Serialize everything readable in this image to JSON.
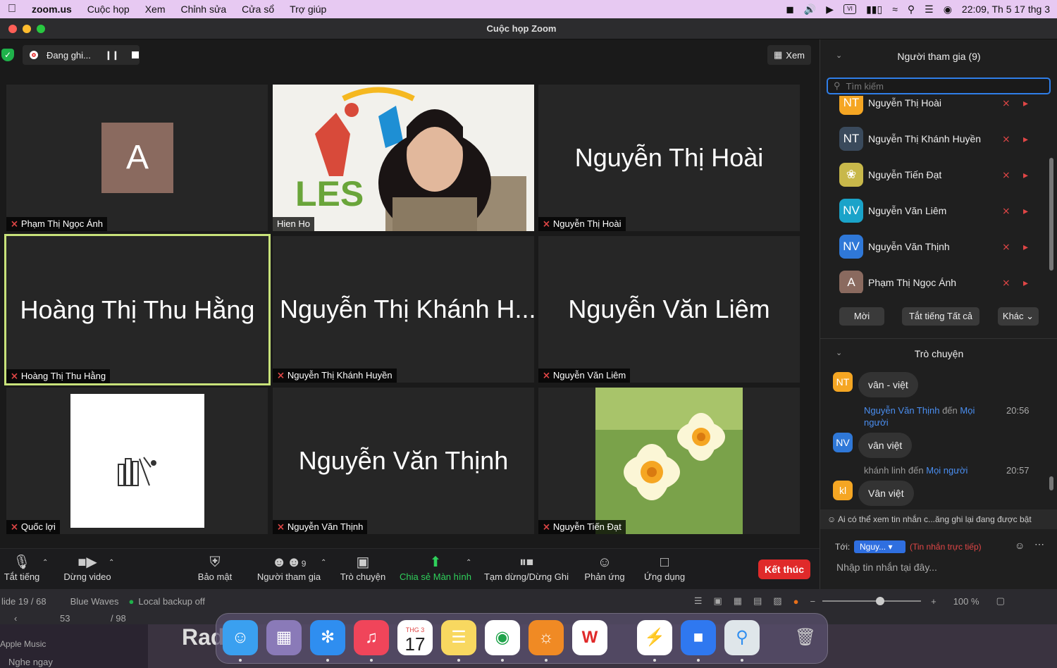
{
  "menubar": {
    "app": "zoom.us",
    "items": [
      "Cuộc họp",
      "Xem",
      "Chỉnh sửa",
      "Cửa sổ",
      "Trợ giúp"
    ],
    "clock": "22:09, Th 5 17 thg 3"
  },
  "window": {
    "title": "Cuộc họp Zoom"
  },
  "recording": {
    "label": "Đang ghi..."
  },
  "view_button": "Xem",
  "tiles": [
    {
      "display": "A",
      "label": "Phạm Thị Ngọc Ánh",
      "type": "avatar",
      "color": "#8a6a5f"
    },
    {
      "display": "",
      "label": "Hien Ho",
      "type": "video"
    },
    {
      "display": "Nguyễn Thị Hoài",
      "label": "Nguyễn Thị Hoài",
      "type": "name"
    },
    {
      "display": "Hoàng Thị Thu Hằng",
      "label": "Hoàng Thị Thu Hằng",
      "type": "name"
    },
    {
      "display": "Nguyễn Thị Khánh H...",
      "label": "Nguyễn Thị Khánh Huyền",
      "type": "name"
    },
    {
      "display": "Nguyễn Văn Liêm",
      "label": "Nguyễn Văn Liêm",
      "type": "name"
    },
    {
      "display": "",
      "label": "Quốc lợi",
      "type": "image"
    },
    {
      "display": "Nguyễn Văn Thịnh",
      "label": "Nguyễn Văn Thịnh",
      "type": "name"
    },
    {
      "display": "",
      "label": "Nguyễn Tiến Đạt",
      "type": "flower"
    }
  ],
  "les_text": "LES",
  "toolbar": {
    "mute": "Tắt tiếng",
    "video": "Dừng video",
    "security": "Bảo mật",
    "participants": "Người tham gia",
    "participants_count": "9",
    "chat": "Trò chuyện",
    "share": "Chia sẻ Màn hình",
    "record": "Tạm dừng/Dừng Ghi",
    "reactions": "Phản ứng",
    "apps": "Ứng dụng",
    "end": "Kết thúc"
  },
  "participants_panel": {
    "title": "Người tham gia (9)",
    "search_placeholder": "Tìm kiếm",
    "list": [
      {
        "initials": "NT",
        "name": "Nguyễn Thị Hoài",
        "color": "#f5a623"
      },
      {
        "initials": "NT",
        "name": "Nguyễn Thị Khánh Huyền",
        "color": "#3a4a5c"
      },
      {
        "initials": "",
        "name": "Nguyễn Tiến Đạt",
        "color": "#c8b84a"
      },
      {
        "initials": "NV",
        "name": "Nguyễn Văn Liêm",
        "color": "#1aa3c9"
      },
      {
        "initials": "NV",
        "name": "Nguyễn Văn Thịnh",
        "color": "#2f78d8"
      },
      {
        "initials": "A",
        "name": "Phạm Thị Ngọc Ánh",
        "color": "#8a6a5f"
      }
    ],
    "invite": "Mời",
    "mute_all": "Tắt tiếng Tất cả",
    "more": "Khác"
  },
  "chat_panel": {
    "title": "Trò chuyện",
    "messages": [
      {
        "initials": "NT",
        "color": "#f5a623",
        "text": "vân - việt"
      },
      {
        "from": "Nguyễn Văn Thịnh",
        "to_word": "đến",
        "to": "Mọi người",
        "time": "20:56"
      },
      {
        "initials": "NV",
        "color": "#2f78d8",
        "text": "vân việt"
      },
      {
        "from": "khánh linh",
        "to_word": "đến",
        "to": "Mọi người",
        "time": "20:57"
      },
      {
        "initials": "kl",
        "color": "#f5a623",
        "text": "Vân việt"
      }
    ],
    "notice": "Ai có thể xem tin nhắn c...ăng ghi lại đang được bật",
    "to_label": "Tới:",
    "to_value": "Nguy...",
    "direct": "(Tin nhắn trực tiếp)",
    "input_placeholder": "Nhập tin nhắn tại đây..."
  },
  "background_app": {
    "slide": "lide 19 / 68",
    "theme": "Blue Waves",
    "backup": "Local backup off",
    "zoom": "100 %",
    "page": "53",
    "total": "/ 98",
    "music_title": "Apple Music",
    "music_action": "Nghe ngay",
    "partial_text": "Rad"
  },
  "dock": {
    "calendar_month": "THG 3",
    "calendar_day": "17"
  }
}
